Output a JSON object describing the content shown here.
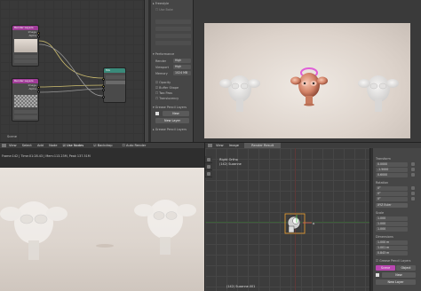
{
  "node_editor": {
    "nodes": [
      {
        "title": "Render Layers"
      },
      {
        "title": "Render Layers"
      },
      {
        "title": "Mix"
      },
      {
        "title": "Composite"
      }
    ],
    "image_label": "Image",
    "alpha_label": "Alpha",
    "z_label": "Z",
    "scene_label": "Scene"
  },
  "properties": {
    "header": "Freestyle",
    "use_bake": "Use Bake",
    "perf_label": "Performance",
    "rows": [
      {
        "label": "Render",
        "value": "High"
      },
      {
        "label": "Viewport",
        "value": "High"
      },
      {
        "label": "Memory",
        "value": "1024 MB"
      }
    ],
    "checks": [
      "Opacity",
      "Buffer Shape",
      "Two Pass",
      "Translucency"
    ],
    "pencil_header": "Grease Pencil Layers",
    "new_button": "New",
    "new_layer_button": "New Layer",
    "collapsed_header": "Grease Pencil Layers"
  },
  "menubar": {
    "items": [
      "View",
      "Select",
      "Add",
      "Node",
      "Use Nodes",
      "Backdrop",
      "Auto Render"
    ],
    "items2": [
      "View",
      "Image",
      "Render Result"
    ]
  },
  "image_editor": {
    "status": "Frame:142 | Time:01:28.43 | Mem:113.23M, Peak 137.51M"
  },
  "viewport": {
    "label": "Right Ortho",
    "sub_label": "(142) Suzanne",
    "bottom_status": "(142) Suzanne.001"
  },
  "n_panel": {
    "sections": [
      {
        "title": "Transform",
        "values": [
          "0.0000",
          "-1.5000",
          "0.6000"
        ]
      },
      {
        "title": "Rotation",
        "values": [
          "0°",
          "0°",
          "0°"
        ]
      },
      {
        "title": "XYZ Euler",
        "values": []
      },
      {
        "title": "Scale",
        "values": [
          "1.000",
          "1.000",
          "1.000"
        ]
      },
      {
        "title": "Dimensions",
        "values": [
          "1.000 m",
          "1.001 m",
          "0.843 m"
        ]
      }
    ],
    "grease_header": "Grease Pencil Layers",
    "scene_btn": "Scene",
    "object_btn": "Object",
    "new_btn": "New",
    "new_layer_btn": "New Layer"
  },
  "colors": {
    "accent_pink": "#b846b0",
    "node_blue": "#2e6a8a",
    "node_teal": "#3a8a7a",
    "bg_dark": "#2b2b2b"
  }
}
